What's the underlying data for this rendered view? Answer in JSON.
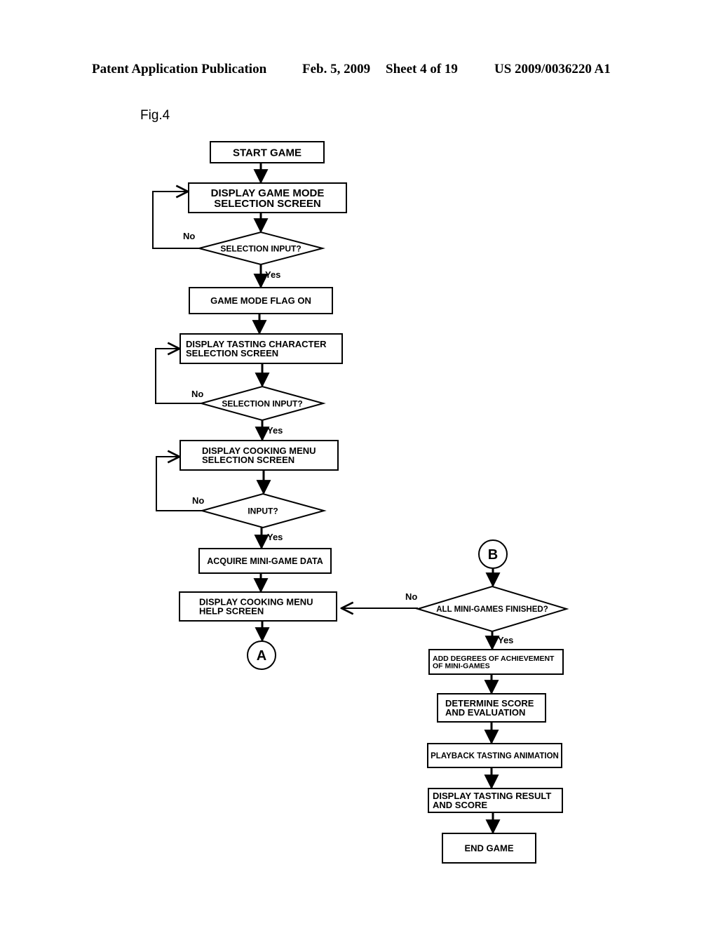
{
  "header": {
    "publication": "Patent Application Publication",
    "date": "Feb. 5, 2009",
    "sheet": "Sheet 4 of 19",
    "number": "US 2009/0036220 A1"
  },
  "figure": {
    "label": "Fig.4"
  },
  "flowchart": {
    "nodes": [
      {
        "id": "start",
        "type": "process",
        "lines": [
          "START GAME"
        ]
      },
      {
        "id": "mode_screen",
        "type": "process",
        "lines": [
          "DISPLAY GAME MODE",
          "SELECTION SCREEN"
        ]
      },
      {
        "id": "mode_input",
        "type": "decision",
        "lines": [
          "SELECTION INPUT?"
        ]
      },
      {
        "id": "mode_flag",
        "type": "process",
        "lines": [
          "GAME MODE FLAG ON"
        ]
      },
      {
        "id": "char_screen",
        "type": "process",
        "lines": [
          "DISPLAY TASTING CHARACTER",
          "SELECTION SCREEN"
        ]
      },
      {
        "id": "char_input",
        "type": "decision",
        "lines": [
          "SELECTION INPUT?"
        ]
      },
      {
        "id": "menu_screen",
        "type": "process",
        "lines": [
          "DISPLAY COOKING MENU",
          "SELECTION SCREEN"
        ]
      },
      {
        "id": "menu_input",
        "type": "decision",
        "lines": [
          "INPUT?"
        ]
      },
      {
        "id": "acquire",
        "type": "process",
        "lines": [
          "ACQUIRE MINI-GAME DATA"
        ]
      },
      {
        "id": "help",
        "type": "process",
        "lines": [
          "DISPLAY COOKING MENU",
          "HELP SCREEN"
        ]
      },
      {
        "id": "conn_a",
        "type": "connector",
        "lines": [
          "A"
        ]
      },
      {
        "id": "conn_b",
        "type": "connector",
        "lines": [
          "B"
        ]
      },
      {
        "id": "all_done",
        "type": "decision",
        "lines": [
          "ALL MINI-GAMES FINISHED?"
        ]
      },
      {
        "id": "add_deg",
        "type": "process",
        "lines": [
          "ADD DEGREES OF ACHIEVEMENT",
          "OF MINI-GAMES"
        ]
      },
      {
        "id": "score",
        "type": "process",
        "lines": [
          "DETERMINE SCORE",
          "AND EVALUATION"
        ]
      },
      {
        "id": "playback",
        "type": "process",
        "lines": [
          "PLAYBACK TASTING ANIMATION"
        ]
      },
      {
        "id": "result",
        "type": "process",
        "lines": [
          "DISPLAY TASTING RESULT",
          "AND SCORE"
        ]
      },
      {
        "id": "end",
        "type": "process",
        "lines": [
          "END GAME"
        ]
      }
    ],
    "edges": [
      {
        "from": "start",
        "to": "mode_screen",
        "label": ""
      },
      {
        "from": "mode_screen",
        "to": "mode_input",
        "label": ""
      },
      {
        "from": "mode_input",
        "to": "mode_screen",
        "label": "No"
      },
      {
        "from": "mode_input",
        "to": "mode_flag",
        "label": "Yes"
      },
      {
        "from": "mode_flag",
        "to": "char_screen",
        "label": ""
      },
      {
        "from": "char_screen",
        "to": "char_input",
        "label": ""
      },
      {
        "from": "char_input",
        "to": "char_screen",
        "label": "No"
      },
      {
        "from": "char_input",
        "to": "menu_screen",
        "label": "Yes"
      },
      {
        "from": "menu_screen",
        "to": "menu_input",
        "label": ""
      },
      {
        "from": "menu_input",
        "to": "menu_screen",
        "label": "No"
      },
      {
        "from": "menu_input",
        "to": "acquire",
        "label": "Yes"
      },
      {
        "from": "acquire",
        "to": "help",
        "label": ""
      },
      {
        "from": "help",
        "to": "conn_a",
        "label": ""
      },
      {
        "from": "conn_b",
        "to": "all_done",
        "label": ""
      },
      {
        "from": "all_done",
        "to": "help",
        "label": "No"
      },
      {
        "from": "all_done",
        "to": "add_deg",
        "label": "Yes"
      },
      {
        "from": "add_deg",
        "to": "score",
        "label": ""
      },
      {
        "from": "score",
        "to": "playback",
        "label": ""
      },
      {
        "from": "playback",
        "to": "result",
        "label": ""
      },
      {
        "from": "result",
        "to": "end",
        "label": ""
      }
    ]
  }
}
